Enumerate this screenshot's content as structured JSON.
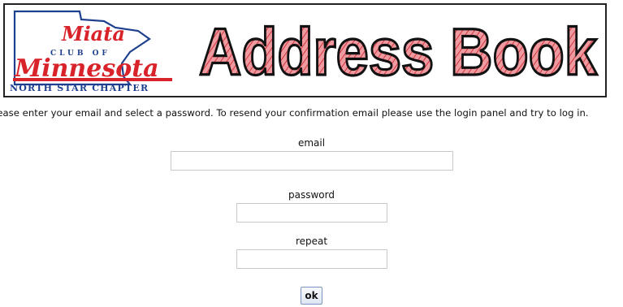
{
  "banner": {
    "logo_text_top": "Miata",
    "logo_text_middle": "CLUB OF",
    "logo_text_main": "Minnesota",
    "logo_text_bottom": "NORTH STAR CHAPTER",
    "title": "Address Book"
  },
  "instructions": "Please enter your email and select a password. To resend your confirmation email please use the login panel and try to log in.",
  "form": {
    "email": {
      "label": "email",
      "value": "",
      "placeholder": ""
    },
    "password": {
      "label": "password",
      "value": "",
      "placeholder": ""
    },
    "repeat": {
      "label": "repeat",
      "value": "",
      "placeholder": ""
    },
    "ok_label": "ok"
  },
  "colors": {
    "logo_red": "#d8232a",
    "logo_blue": "#1f3f8f",
    "title_fill": "#e9878c",
    "title_stroke": "#111111",
    "button_border": "#7a95c4"
  }
}
